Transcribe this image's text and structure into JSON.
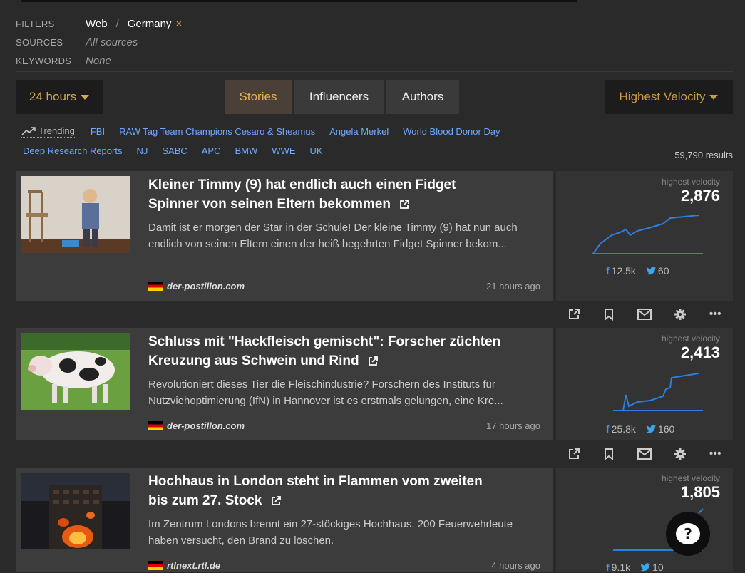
{
  "filters": {
    "filters_label": "FILTERS",
    "scope": "Web",
    "separator": "/",
    "country": "Germany",
    "remove_icon": "×",
    "sources_label": "SOURCES",
    "sources_value": "All sources",
    "keywords_label": "KEYWORDS",
    "keywords_value": "None"
  },
  "toolbar": {
    "time_range": "24 hours",
    "tabs": [
      {
        "label": "Stories",
        "active": true
      },
      {
        "label": "Influencers",
        "active": false
      },
      {
        "label": "Authors",
        "active": false
      }
    ],
    "sort": "Highest Velocity"
  },
  "trending": {
    "label": "Trending",
    "row1": [
      "FBI",
      "RAW Tag Team Champions Cesaro & Sheamus",
      "Angela Merkel",
      "World Blood Donor Day"
    ],
    "row2": [
      "Deep Research Reports",
      "NJ",
      "SABC",
      "APC",
      "BMW",
      "WWE",
      "UK"
    ],
    "results": "59,790 results"
  },
  "stories": [
    {
      "title": "Kleiner Timmy (9) hat endlich auch einen Fidget Spinner von seinen Eltern bekommen",
      "description": "Damit ist er morgen der Star in der Schule! Der kleine Timmy (9) hat nun auch endlich von seinen Eltern einen der heiß begehrten Fidget Spinner bekom...",
      "source": "der-postillon.com",
      "time": "21 hours ago",
      "velocity_label": "highest velocity",
      "velocity": "2,876",
      "facebook": "12.5k",
      "twitter": "60"
    },
    {
      "title": "Schluss mit \"Hackfleisch gemischt\": Forscher züchten Kreuzung aus Schwein und Rind",
      "description": "Revolutioniert dieses Tier die Fleischindustrie? Forschern des Instituts für Nutzviehoptimierung (IfN) in Hannover ist es erstmals gelungen, eine Kre...",
      "source": "der-postillon.com",
      "time": "17 hours ago",
      "velocity_label": "highest velocity",
      "velocity": "2,413",
      "facebook": "25.8k",
      "twitter": "160"
    },
    {
      "title": "Hochhaus in London steht in Flammen vom zweiten bis zum 27. Stock",
      "description": "Im Zentrum Londons brennt ein 27-stöckiges Hochhaus. 200 Feuerwehrleute haben versucht, den Brand zu löschen.",
      "source": "rtlnext.rtl.de",
      "time": "4 hours ago",
      "velocity_label": "highest velocity",
      "velocity": "1,805",
      "facebook": "9.1k",
      "twitter": "10"
    }
  ],
  "icons": {
    "facebook": "f",
    "chat": "?",
    "more": "•••"
  }
}
